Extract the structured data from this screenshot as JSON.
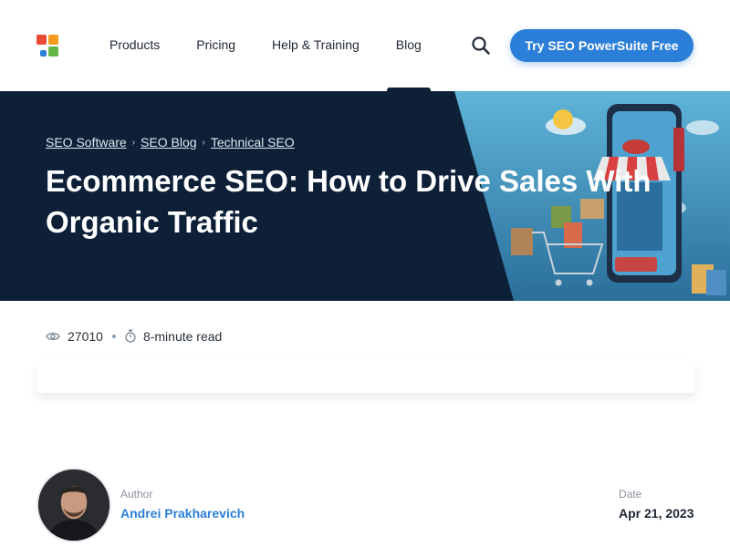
{
  "header": {
    "logo_icon": "seo-powersuite-logo-icon",
    "nav": [
      {
        "label": "Products"
      },
      {
        "label": "Pricing"
      },
      {
        "label": "Help & Training"
      },
      {
        "label": "Blog",
        "active": true
      }
    ],
    "search_icon": "search-icon",
    "cta_label": "Try SEO PowerSuite Free",
    "colors": {
      "accent": "#2b7fd9",
      "hero_bg": "#0d2038"
    }
  },
  "hero": {
    "breadcrumbs": [
      {
        "label": "SEO Software"
      },
      {
        "label": "SEO Blog"
      },
      {
        "label": "Technical SEO"
      }
    ],
    "title": "Ecommerce SEO: How to Drive Sales With Organic Traffic"
  },
  "meta": {
    "views": "27010",
    "read_time": "8-minute read"
  },
  "author": {
    "label": "Author",
    "name": "Andrei Prakharevich",
    "date_label": "Date",
    "date": "Apr 21, 2023"
  }
}
